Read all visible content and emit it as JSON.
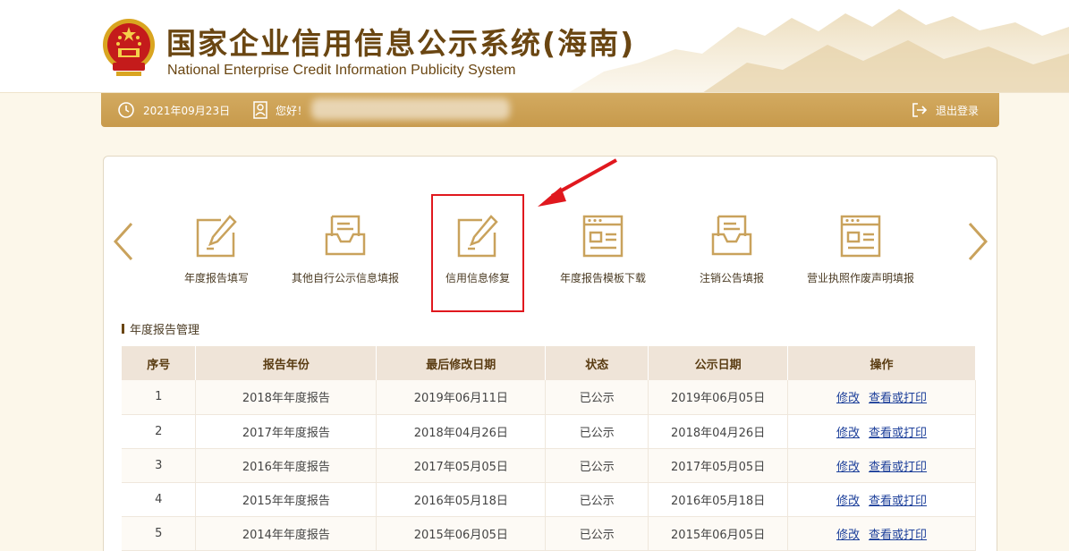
{
  "header": {
    "title_cn": "国家企业信用信息公示系统(海南)",
    "title_en": "National Enterprise Credit Information Publicity System"
  },
  "info_bar": {
    "date": "2021年09月23日",
    "greeting": "您好！",
    "logout_label": "退出登录"
  },
  "functions": [
    {
      "label": "年度报告填写",
      "icon": "edit-form-icon"
    },
    {
      "label": "其他自行公示信息填报",
      "icon": "inbox-icon"
    },
    {
      "label": "信用信息修复",
      "icon": "edit-form-icon",
      "highlighted": true
    },
    {
      "label": "年度报告模板下载",
      "icon": "template-window-icon"
    },
    {
      "label": "注销公告填报",
      "icon": "inbox-icon"
    },
    {
      "label": "营业执照作废声明填报",
      "icon": "template-window-icon"
    }
  ],
  "section": {
    "title": "年度报告管理"
  },
  "table": {
    "headers": [
      "序号",
      "报告年份",
      "最后修改日期",
      "状态",
      "公示日期",
      "操作"
    ],
    "edit_label": "修改",
    "view_label": "查看或打印",
    "rows": [
      {
        "no": "1",
        "year": "2018年年度报告",
        "modified": "2019年06月11日",
        "status": "已公示",
        "published": "2019年06月05日"
      },
      {
        "no": "2",
        "year": "2017年年度报告",
        "modified": "2018年04月26日",
        "status": "已公示",
        "published": "2018年04月26日"
      },
      {
        "no": "3",
        "year": "2016年年度报告",
        "modified": "2017年05月05日",
        "status": "已公示",
        "published": "2017年05月05日"
      },
      {
        "no": "4",
        "year": "2015年年度报告",
        "modified": "2016年05月18日",
        "status": "已公示",
        "published": "2016年05月18日"
      },
      {
        "no": "5",
        "year": "2014年年度报告",
        "modified": "2015年06月05日",
        "status": "已公示",
        "published": "2015年06月05日"
      }
    ]
  },
  "colors": {
    "brand_gold": "#c99d4f",
    "title_brown": "#6a4612",
    "highlight_red": "#e0181e",
    "link_blue": "#1c3f9a"
  }
}
